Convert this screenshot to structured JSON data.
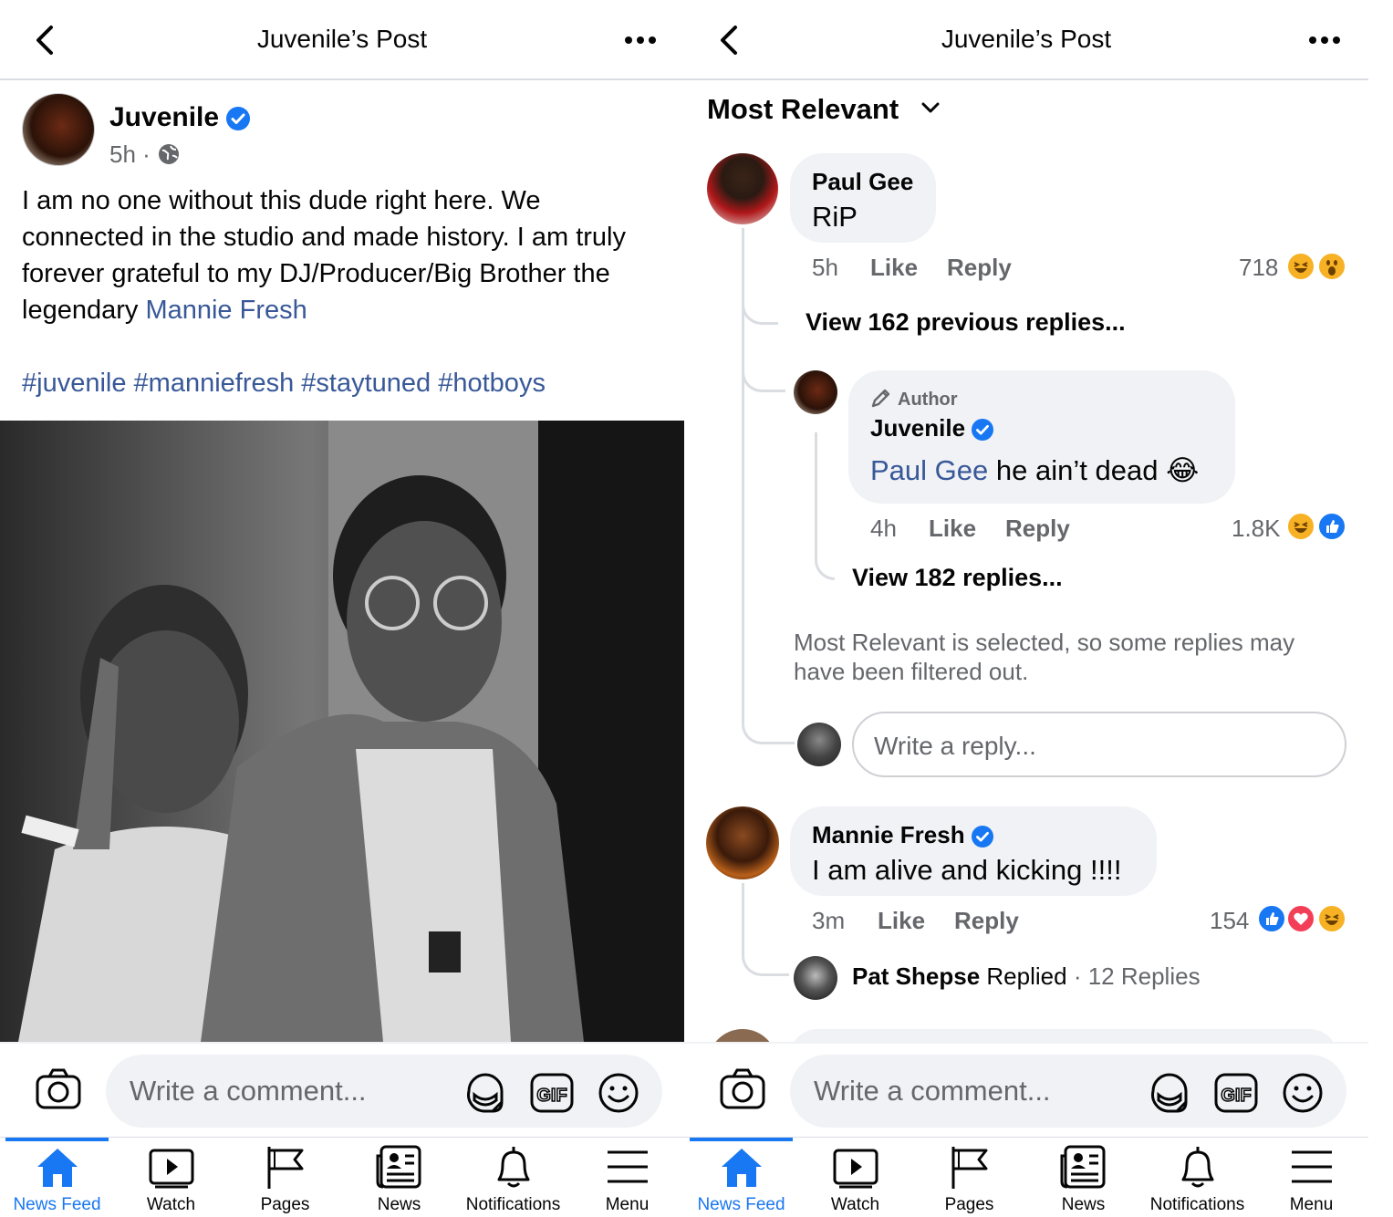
{
  "header": {
    "title": "Juvenile’s Post"
  },
  "post": {
    "author": "Juvenile",
    "time": "5h",
    "text_before_mention": "I am no one without this dude right here. We connected in the studio and made history. I am truly forever grateful to my DJ/Producer/Big Brother the legendary",
    "mention": "Mannie Fresh",
    "hashtags": "#juvenile #manniefresh #staytuned #hotboys"
  },
  "comments": {
    "sort_label": "Most Relevant",
    "first": {
      "author": "Paul Gee",
      "text": "RiP",
      "time": "5h",
      "like": "Like",
      "reply": "Reply",
      "count": "718",
      "reactions": [
        "haha",
        "wow"
      ]
    },
    "view_previous": "View 162 previous replies...",
    "author_reply": {
      "badge": "Author",
      "author": "Juvenile",
      "mention": "Paul Gee",
      "text": "he ain’t dead",
      "emoji": "😂",
      "time": "4h",
      "like": "Like",
      "reply": "Reply",
      "count": "1.8K",
      "reactions": [
        "haha",
        "like"
      ]
    },
    "view_replies": "View 182 replies...",
    "filter_note": "Most Relevant is selected, so some replies may have been filtered out.",
    "reply_placeholder": "Write a reply...",
    "second": {
      "author": "Mannie Fresh",
      "text": "I am alive and kicking !!!!",
      "time": "3m",
      "like": "Like",
      "reply": "Reply",
      "count": "154",
      "reactions": [
        "like",
        "love",
        "haha"
      ]
    },
    "replied_summary": {
      "name": "Pat Shepse",
      "action": "Replied",
      "separator": "·",
      "count": "12 Replies"
    }
  },
  "composer": {
    "placeholder": "Write a comment..."
  },
  "tabs": [
    {
      "label": "News Feed",
      "icon": "home-icon",
      "active": true
    },
    {
      "label": "Watch",
      "icon": "watch-icon",
      "active": false
    },
    {
      "label": "Pages",
      "icon": "flag-icon",
      "active": false
    },
    {
      "label": "News",
      "icon": "news-icon",
      "active": false
    },
    {
      "label": "Notifications",
      "icon": "bell-icon",
      "active": false
    },
    {
      "label": "Menu",
      "icon": "menu-icon",
      "active": false
    }
  ],
  "colors": {
    "accent": "#1877f2",
    "link": "#385898",
    "bubble": "#f0f2f5",
    "muted": "#65676b"
  }
}
